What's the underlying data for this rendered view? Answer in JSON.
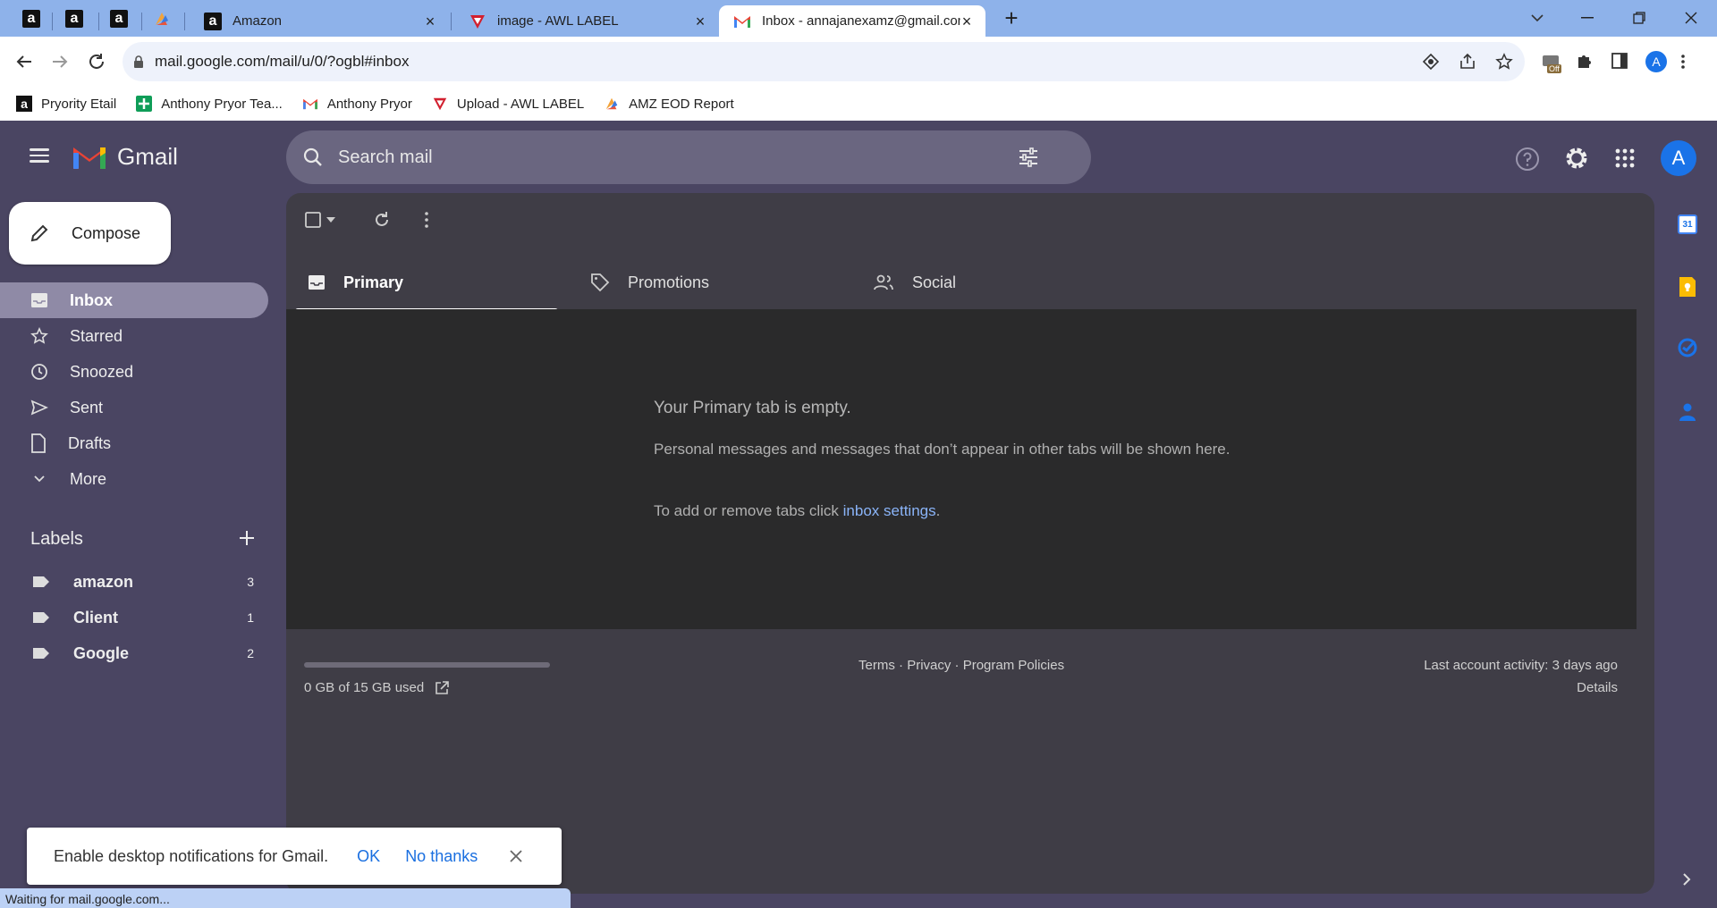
{
  "browser": {
    "tabs": [
      {
        "title": "Amazon"
      },
      {
        "title": "image - AWL LABEL"
      },
      {
        "title": "Inbox - annajanexamz@gmail.com"
      }
    ],
    "url": "mail.google.com/mail/u/0/?ogbl#inbox",
    "profile_initial": "A",
    "extension_badge": "Off",
    "bookmarks": [
      {
        "label": "Pryority Etail",
        "icon": "amazon-icon"
      },
      {
        "label": "Anthony Pryor Tea...",
        "icon": "green-plus-icon"
      },
      {
        "label": "Anthony Pryor",
        "icon": "gmail-icon"
      },
      {
        "label": "Upload - AWL LABEL",
        "icon": "awl-icon"
      },
      {
        "label": "AMZ EOD Report",
        "icon": "ai-icon"
      }
    ],
    "status_text": "Waiting for mail.google.com..."
  },
  "gmail": {
    "app_name": "Gmail",
    "search_placeholder": "Search mail",
    "compose_label": "Compose",
    "nav": [
      {
        "label": "Inbox",
        "icon": "inbox-icon",
        "active": true
      },
      {
        "label": "Starred",
        "icon": "star-icon"
      },
      {
        "label": "Snoozed",
        "icon": "clock-icon"
      },
      {
        "label": "Sent",
        "icon": "send-icon"
      },
      {
        "label": "Drafts",
        "icon": "draft-icon"
      },
      {
        "label": "More",
        "icon": "chevron-down-icon"
      }
    ],
    "labels_heading": "Labels",
    "labels": [
      {
        "name": "amazon",
        "count": "3"
      },
      {
        "name": "Client",
        "count": "1"
      },
      {
        "name": "Google",
        "count": "2"
      }
    ],
    "category_tabs": [
      {
        "label": "Primary",
        "icon": "inbox-tray-icon",
        "active": true
      },
      {
        "label": "Promotions",
        "icon": "tag-icon"
      },
      {
        "label": "Social",
        "icon": "people-icon"
      }
    ],
    "empty": {
      "title": "Your Primary tab is empty.",
      "body": "Personal messages and messages that don’t appear in other tabs will be shown here.",
      "settings_prefix": "To add or remove tabs click ",
      "settings_link": "inbox settings",
      "settings_suffix": "."
    },
    "footer": {
      "storage": "0 GB of 15 GB used",
      "storage_fraction": 0.0,
      "terms": "Terms",
      "privacy": "Privacy",
      "policies": "Program Policies",
      "dot": "·",
      "activity": "Last account activity: 3 days ago",
      "details": "Details"
    },
    "avatar_initial": "A",
    "calendar_day": "31",
    "notification": {
      "text": "Enable desktop notifications for Gmail.",
      "ok": "OK",
      "no_thanks": "No thanks"
    }
  },
  "colors": {
    "tab_strip": "#8eb2ea",
    "gmail_bg": "#4a4562",
    "link_blue": "#8ab4f8",
    "avatar": "#1a73e8"
  }
}
